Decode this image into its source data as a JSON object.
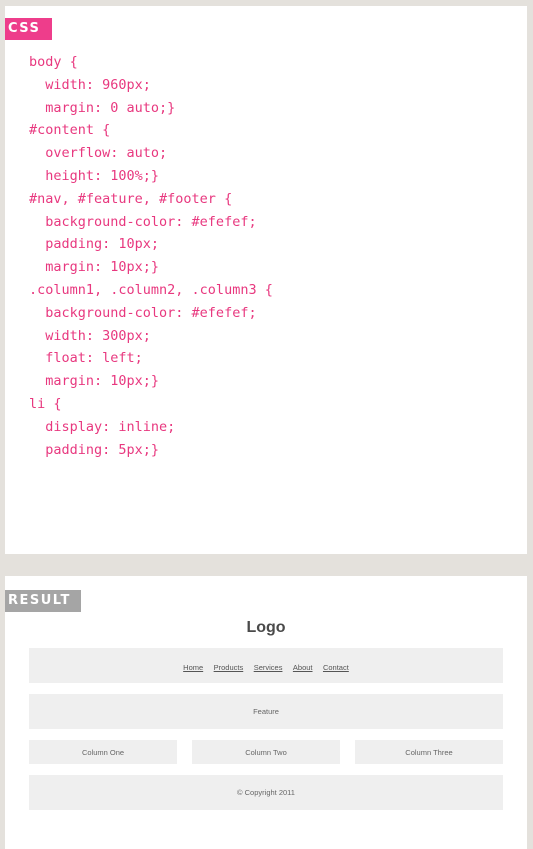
{
  "css_panel": {
    "label": "CSS",
    "lines": [
      "body {",
      "  width: 960px;",
      "  margin: 0 auto;}",
      "#content {",
      "  overflow: auto;",
      "  height: 100%;}",
      "#nav, #feature, #footer {",
      "  background-color: #efefef;",
      "  padding: 10px;",
      "  margin: 10px;}",
      ".column1, .column2, .column3 {",
      "  background-color: #efefef;",
      "  width: 300px;",
      "  float: left;",
      "  margin: 10px;}",
      "li {",
      "  display: inline;",
      "  padding: 5px;}"
    ]
  },
  "result_panel": {
    "label": "RESULT",
    "logo": "Logo",
    "nav_items": [
      "Home",
      "Products",
      "Services",
      "About",
      "Contact"
    ],
    "feature": "Feature",
    "columns": [
      "Column One",
      "Column Two",
      "Column Three"
    ],
    "footer": "© Copyright 2011"
  },
  "colors": {
    "css_accent": "#ee3d8b",
    "code_text": "#e8387f",
    "result_label_bg": "#a5a5a5",
    "box_bg": "#efefef",
    "page_bg": "#e4e1dc"
  }
}
